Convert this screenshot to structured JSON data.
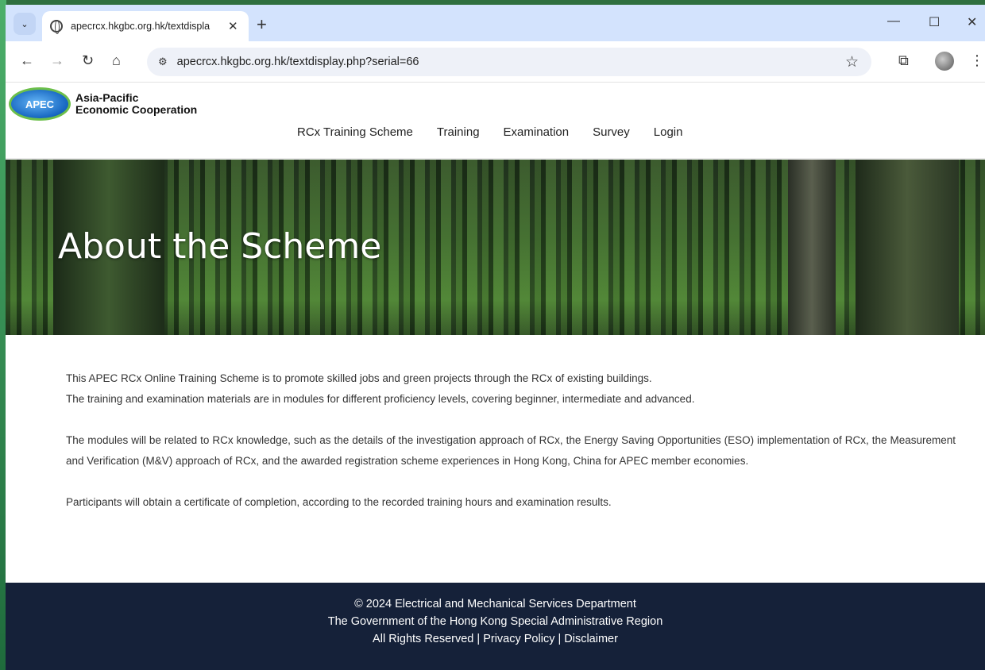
{
  "browser": {
    "tab_title": "apecrcx.hkgbc.org.hk/textdispla",
    "url": "apecrcx.hkgbc.org.hk/textdisplay.php?serial=66"
  },
  "site": {
    "logo_line1": "Asia-Pacific",
    "logo_line2": "Economic Cooperation",
    "logo_mark": "APEC",
    "nav": [
      "RCx Training Scheme",
      "Training",
      "Examination",
      "Survey",
      "Login"
    ]
  },
  "hero": {
    "title": "About the Scheme"
  },
  "content": {
    "p1_line1": "This APEC RCx Online Training Scheme is to promote skilled jobs and green projects through the RCx of existing buildings.",
    "p1_line2": "The training and examination materials are in modules for different proficiency levels, covering beginner, intermediate and advanced.",
    "p2": "The modules will be related to RCx knowledge, such as the details of the investigation approach of RCx, the Energy Saving Opportunities (ESO) implementation of RCx, the Measurement and Verification (M&V) approach of RCx, and the awarded registration scheme experiences in Hong Kong, China for APEC member economies.",
    "p3": "Participants will obtain a certificate of completion, according to the recorded training hours and examination results."
  },
  "footer": {
    "line1": "© 2024 Electrical and Mechanical Services Department",
    "line2": "The Government of the Hong Kong Special Administrative Region",
    "line3": "All Rights Reserved | Privacy Policy | Disclaimer"
  }
}
